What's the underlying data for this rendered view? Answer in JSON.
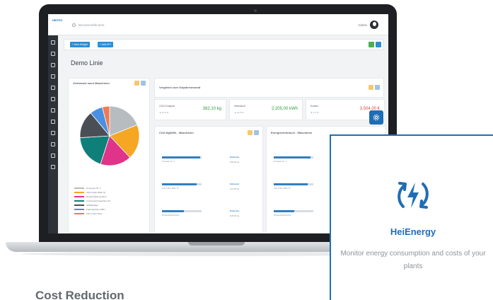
{
  "app": {
    "logo_text": "HEITEC",
    "search_placeholder": "Benutzerdefinierte",
    "user_name": "Admin",
    "actions": {
      "new_widget": "+ New Widget",
      "add_kpi": "+ Add KPI"
    },
    "page_title": "Demo Linie",
    "cards": {
      "pie": {
        "title": "Verbrauch nach Maschinen"
      },
      "compare": {
        "title": "Vergleich zum Vorjahresmonat"
      },
      "co2": {
        "title": "CO2-Ng/kWh - Maschinen"
      },
      "energy": {
        "title": "Energieverbrauch - Maschinen"
      }
    },
    "kpis": [
      {
        "label": "CO2-Footprint",
        "sub": "▲ 12,3 %",
        "value": "382,10 kg",
        "color": "#2e9a3c"
      },
      {
        "label": "Verbrauch",
        "sub": "▲ 12,3 %",
        "value": "2.205,00 kWh",
        "color": "#2e9a3c"
      },
      {
        "label": "Kosten",
        "sub": "▼ 4,1 %",
        "value": "3.504,00 €",
        "color": "#d9473a"
      }
    ],
    "pie_legend": [
      {
        "label": "Temperier Nr. 2",
        "color": "#b7bcc1"
      },
      {
        "label": "CNC Fräse DMG 70",
        "color": "#f5a623"
      },
      {
        "label": "Rundschleifmaschine",
        "color": "#e0338a"
      },
      {
        "label": "3-Achs-Drehmaschine 33",
        "color": "#0f7f7a"
      },
      {
        "label": "Abfüllanlage",
        "color": "#4a4f55"
      },
      {
        "label": "Fräsmaschine DMU",
        "color": "#4a90e2"
      },
      {
        "label": "CNC Laser Fiber",
        "color": "#ef7a54"
      }
    ],
    "co2_bars": [
      {
        "caption": "Temperier Nr. 2",
        "key": "Emission",
        "value": "168,00 kg",
        "fill": 0.96
      },
      {
        "caption": "CNC Fräse DMG 70",
        "key": "Emission",
        "value": "170,00 kg",
        "fill": 0.88
      },
      {
        "caption": "Rundschleifmaschine",
        "key": "Emission",
        "value": "108,00 kg",
        "fill": 0.55
      }
    ],
    "energy_bars": [
      {
        "caption": "Temperier Nr. 2",
        "fill": 0.92
      },
      {
        "caption": "CNC Fräse DMG 70",
        "fill": 0.86
      },
      {
        "caption": "Rundschleifmaschine",
        "fill": 0.52
      }
    ]
  },
  "overlay": {
    "title": "HeiEnergy",
    "description": "Monitor energy consumption and costs of your plants",
    "accent": "#1f6db5"
  },
  "section_heading": "Cost Reduction"
}
